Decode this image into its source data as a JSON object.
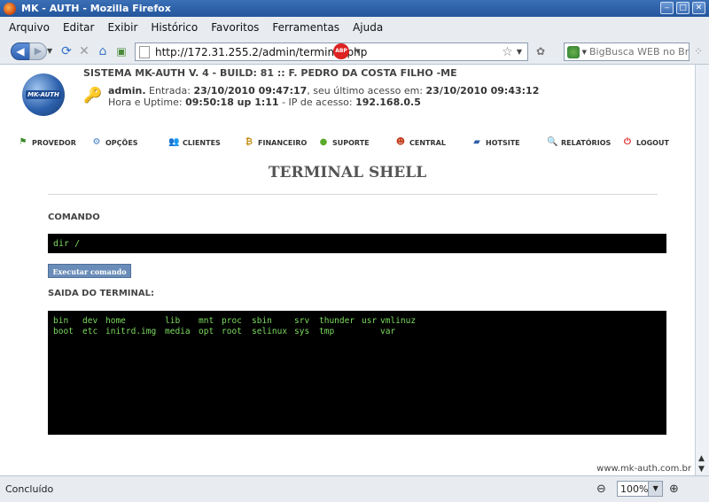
{
  "window": {
    "title": "MK - AUTH - Mozilla Firefox"
  },
  "menu": [
    "Arquivo",
    "Editar",
    "Exibir",
    "Histórico",
    "Favoritos",
    "Ferramentas",
    "Ajuda"
  ],
  "nav": {
    "url": "http://172.31.255.2/admin/terminal.php",
    "search_placeholder": "BigBusca WEB no Brasil",
    "adblock_label": "ABP"
  },
  "header": {
    "logo_text": "MK-AUTH",
    "system_line": "SISTEMA MK-AUTH V. 4 - BUILD: 81 :: F. PEDRO DA COSTA FILHO -ME",
    "user": "admin.",
    "entry_label": " Entrada: ",
    "entry_value": "23/10/2010 09:47:17",
    "last_label": ", seu último acesso em: ",
    "last_value": "23/10/2010 09:43:12",
    "uptime_label": "Hora e Uptime: ",
    "uptime_value": "09:50:18 up 1:11",
    "ip_label": " - IP de acesso: ",
    "ip_value": "192.168.0.5"
  },
  "menu_items": [
    "PROVEDOR",
    "OPÇÕES",
    "CLIENTES",
    "FINANCEIRO",
    "SUPORTE",
    "CENTRAL",
    "HOTSITE",
    "RELATÓRIOS",
    "LOGOUT"
  ],
  "page": {
    "heading": "TERMINAL SHELL",
    "command_label": "COMANDO",
    "command_value": "dir /",
    "exec_button": "Executar comando",
    "output_label": "SAIDA DO TERMINAL:",
    "output_row1": [
      "bin",
      "dev",
      "home",
      "lib",
      "mnt",
      "proc",
      "sbin",
      "srv",
      "thunder",
      "usr",
      "vmlinuz"
    ],
    "output_row2": [
      "boot",
      "etc",
      "initrd.img",
      "media",
      "opt",
      "root",
      "selinux",
      "sys",
      "tmp",
      "",
      "var"
    ],
    "footer": "www.mk-auth.com.br"
  },
  "status": {
    "text": "Concluído",
    "zoom": "100%"
  }
}
